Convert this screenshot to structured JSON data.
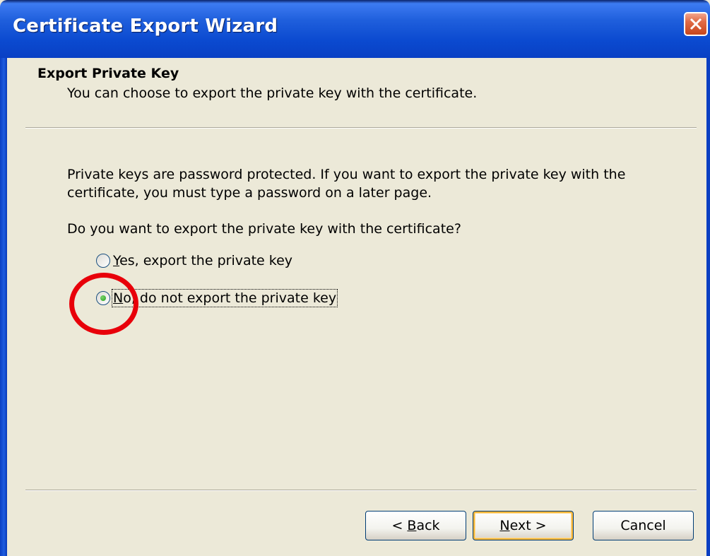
{
  "window": {
    "title": "Certificate Export Wizard",
    "close_icon": "close-icon",
    "titlebar_color": "#0b4ad0",
    "close_color": "#c7461c"
  },
  "header": {
    "heading": "Export Private Key",
    "subheading": "You can choose to export the private key with the certificate."
  },
  "body": {
    "info_text": "Private keys are password protected. If you want to export the private key with the certificate, you must type a password on a later page.",
    "question": "Do you want to export the private key with the certificate?",
    "options": [
      {
        "label_mnemonic": "Y",
        "label_rest": "es, export the private key",
        "selected": false
      },
      {
        "label_mnemonic": "N",
        "label_rest": "o, do not export the private key",
        "selected": true
      }
    ]
  },
  "annotation": {
    "shape": "circle",
    "color": "#e8000a"
  },
  "buttons": {
    "back_prefix": "< ",
    "back_mnemonic": "B",
    "back_rest": "ack",
    "next_mnemonic": "N",
    "next_rest": "ext >",
    "cancel": "Cancel"
  }
}
